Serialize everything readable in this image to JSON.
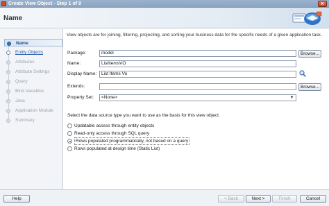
{
  "window": {
    "title": "Create View Object - Step 1 of 9",
    "close_label": "x"
  },
  "header": {
    "step_title": "Name"
  },
  "sidebar": {
    "items": [
      {
        "label": "Name",
        "state": "active"
      },
      {
        "label": "Entity Objects",
        "state": "link"
      },
      {
        "label": "Attributes",
        "state": "disabled"
      },
      {
        "label": "Attribute Settings",
        "state": "disabled"
      },
      {
        "label": "Query",
        "state": "disabled"
      },
      {
        "label": "Bind Variables",
        "state": "disabled"
      },
      {
        "label": "Java",
        "state": "disabled"
      },
      {
        "label": "Application Module",
        "state": "disabled"
      },
      {
        "label": "Summary",
        "state": "disabled"
      }
    ]
  },
  "main": {
    "intro": "View objects are for joining, filtering, projecting, and sorting your business data for the specific needs of a given application task.",
    "fields": {
      "package": {
        "label": "Package:",
        "value": "model",
        "button": "Browse..."
      },
      "name": {
        "label": "Name:",
        "value": "ListItemsVO"
      },
      "display_name": {
        "label": "Display Name:",
        "value": "List Items Vo"
      },
      "extends": {
        "label": "Extends:",
        "value": "",
        "button": "Browse..."
      },
      "property_set": {
        "label": "Property Set:",
        "value": "<None>"
      }
    },
    "datasource": {
      "prompt": "Select the data source type you want to use as the basis for this view object.",
      "options": [
        {
          "label": "Updatable access through entity objects",
          "checked": false
        },
        {
          "label": "Read-only access through SQL query",
          "checked": false
        },
        {
          "label": "Rows populated programmatically, not based on a query",
          "checked": true
        },
        {
          "label": "Rows populated at design time (Static List)",
          "checked": false
        }
      ]
    }
  },
  "footer": {
    "help": "Help",
    "back": "< Back",
    "next": "Next >",
    "finish": "Finish",
    "cancel": "Cancel"
  },
  "colors": {
    "accent": "#3a71b5",
    "titlebar": "#9ab2cc",
    "link": "#2b5fa6"
  }
}
